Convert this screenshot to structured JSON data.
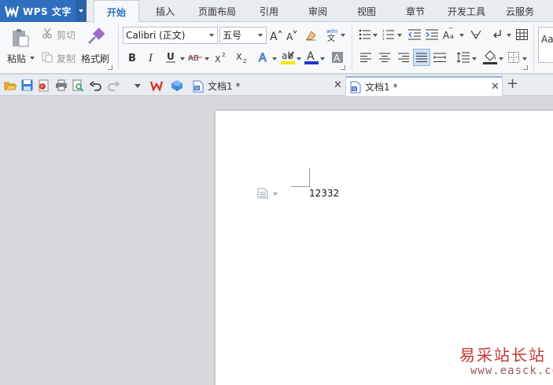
{
  "app": {
    "title": "WPS 文字"
  },
  "menu": {
    "tabs": [
      {
        "label": "开始",
        "active": true
      },
      {
        "label": "插入"
      },
      {
        "label": "页面布局"
      },
      {
        "label": "引用"
      },
      {
        "label": "审阅"
      },
      {
        "label": "视图"
      },
      {
        "label": "章节"
      },
      {
        "label": "开发工具"
      },
      {
        "label": "云服务"
      }
    ]
  },
  "ribbon": {
    "paste_label": "粘贴",
    "cut_label": "剪切",
    "copy_label": "复制",
    "format_painter_label": "格式刷",
    "font_name": "Calibri (正文)",
    "font_size": "五号",
    "style_preview": "Aa"
  },
  "doc_tabs": [
    {
      "label": "文档1 *",
      "active": false
    },
    {
      "label": "文档1 *",
      "active": true
    }
  ],
  "document": {
    "body_text": "12332"
  },
  "watermark": {
    "site_name": "易采站长站",
    "url": "www.easck.com"
  },
  "colors": {
    "accent": "#2f6fbf",
    "font_color_bar": "#2233cc",
    "highlight_bar": "#f5e400",
    "watermark": "#c43434"
  }
}
